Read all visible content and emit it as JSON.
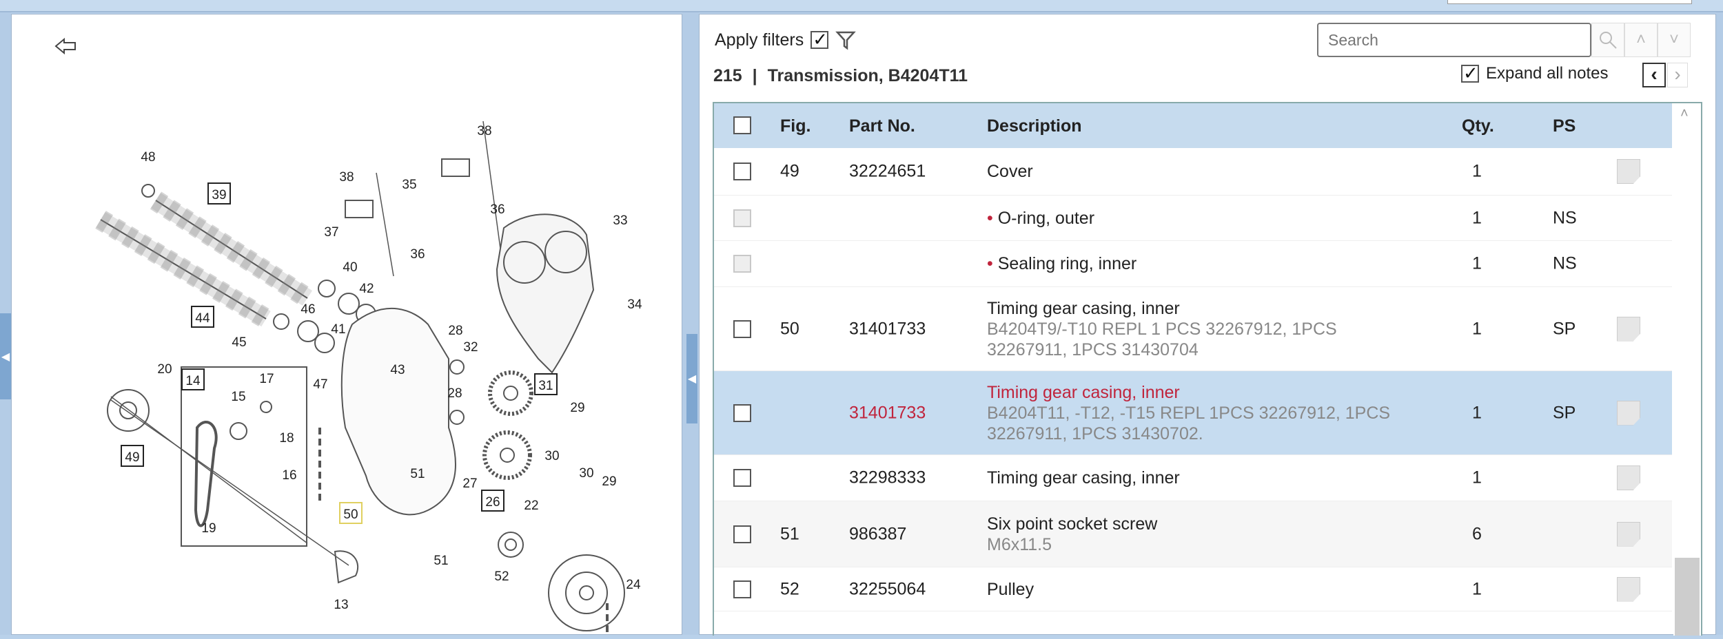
{
  "nav": {
    "collapse_left_icon": "chevron-left-icon",
    "collapse_middle_icon": "chevron-left-icon"
  },
  "diagram": {
    "back_icon": "back-arrow-icon",
    "callouts": [
      "48",
      "39",
      "44",
      "45",
      "46",
      "40",
      "42",
      "41",
      "47",
      "38",
      "38",
      "35",
      "37",
      "36",
      "36",
      "33",
      "34",
      "43",
      "28",
      "32",
      "28",
      "31",
      "29",
      "30",
      "27",
      "30",
      "29",
      "26",
      "22",
      "51",
      "51",
      "52",
      "24",
      "20",
      "14",
      "15",
      "17",
      "18",
      "16",
      "19",
      "49",
      "50",
      "13"
    ]
  },
  "filters": {
    "apply_label": "Apply filters",
    "apply_checked": true,
    "filter_icon": "funnel-icon"
  },
  "search": {
    "placeholder": "Search",
    "search_icon": "magnifier-icon",
    "up_icon": "chevron-up-icon",
    "down_icon": "chevron-down-icon"
  },
  "section": {
    "number": "215",
    "separator": "|",
    "title": "Transmission, B4204T11"
  },
  "notes": {
    "expand_label": "Expand all notes",
    "expand_checked": true,
    "prev": "‹",
    "next": "›"
  },
  "table": {
    "headers": {
      "fig": "Fig.",
      "part": "Part No.",
      "desc": "Description",
      "qty": "Qty.",
      "ps": "PS"
    },
    "rows": [
      {
        "fig": "49",
        "part": "32224651",
        "desc": "Cover",
        "note": "",
        "qty": "1",
        "ps": "",
        "bullet": false,
        "disabled": false,
        "selected": false,
        "has_note": true
      },
      {
        "fig": "",
        "part": "",
        "desc": "O-ring, outer",
        "note": "",
        "qty": "1",
        "ps": "NS",
        "bullet": true,
        "disabled": true,
        "selected": false,
        "has_note": false
      },
      {
        "fig": "",
        "part": "",
        "desc": "Sealing ring, inner",
        "note": "",
        "qty": "1",
        "ps": "NS",
        "bullet": true,
        "disabled": true,
        "selected": false,
        "has_note": false
      },
      {
        "fig": "50",
        "part": "31401733",
        "desc": "Timing gear casing, inner",
        "note": "B4204T9/-T10 REPL 1 PCS 32267912, 1PCS 32267911, 1PCS 31430704",
        "qty": "1",
        "ps": "SP",
        "bullet": false,
        "disabled": false,
        "selected": false,
        "has_note": true
      },
      {
        "fig": "",
        "part": "31401733",
        "desc": "Timing gear casing, inner",
        "note": "B4204T11, -T12, -T15 REPL 1PCS 32267912, 1PCS 32267911, 1PCS 31430702.",
        "qty": "1",
        "ps": "SP",
        "bullet": false,
        "disabled": false,
        "selected": true,
        "has_note": true
      },
      {
        "fig": "",
        "part": "32298333",
        "desc": "Timing gear casing, inner",
        "note": "",
        "qty": "1",
        "ps": "",
        "bullet": false,
        "disabled": false,
        "selected": false,
        "has_note": true
      },
      {
        "fig": "51",
        "part": "986387",
        "desc": "Six point socket screw",
        "note": "M6x11.5",
        "qty": "6",
        "ps": "",
        "bullet": false,
        "disabled": false,
        "selected": false,
        "has_note": true
      },
      {
        "fig": "52",
        "part": "32255064",
        "desc": "Pulley",
        "note": "",
        "qty": "1",
        "ps": "",
        "bullet": false,
        "disabled": false,
        "selected": false,
        "has_note": true
      }
    ]
  },
  "colors": {
    "highlight": "#c6dcf0",
    "accent_red": "#c0243c",
    "panel_blue": "#b4cce6"
  }
}
